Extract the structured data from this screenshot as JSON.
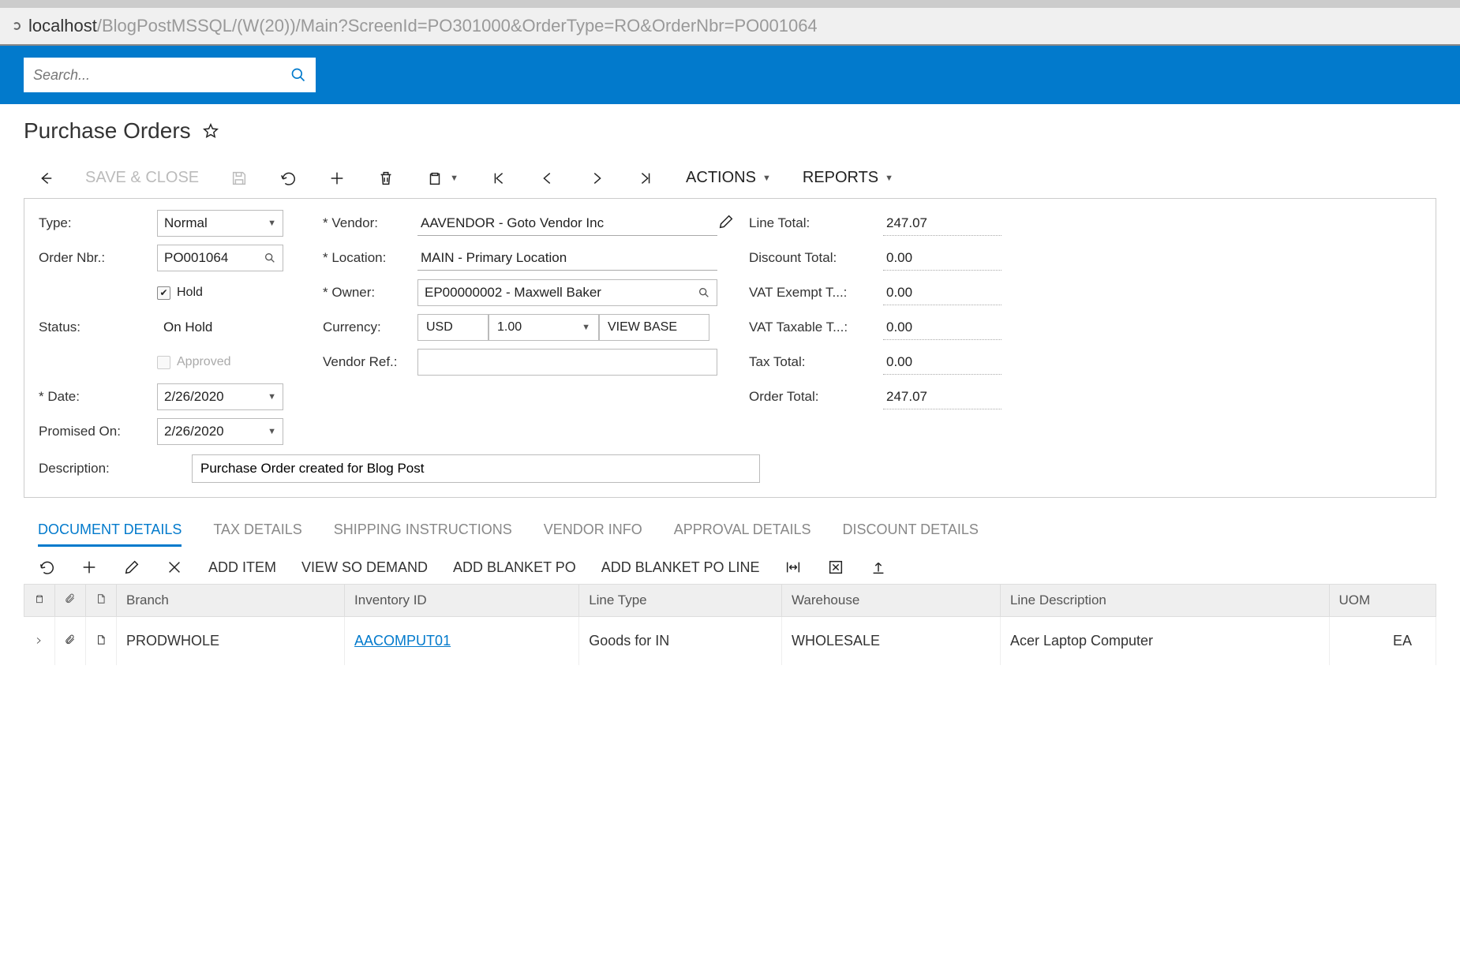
{
  "browser": {
    "url_host": "localhost",
    "url_path": "/BlogPostMSSQL/(W(20))/Main?ScreenId=PO301000&OrderType=RO&OrderNbr=PO001064"
  },
  "search": {
    "placeholder": "Search..."
  },
  "page_title": "Purchase Orders",
  "toolbar": {
    "save_close": "SAVE & CLOSE",
    "actions": "ACTIONS",
    "reports": "REPORTS"
  },
  "form": {
    "type_label": "Type:",
    "type_value": "Normal",
    "order_nbr_label": "Order Nbr.:",
    "order_nbr_value": "PO001064",
    "hold_label": "Hold",
    "status_label": "Status:",
    "status_value": "On Hold",
    "approved_label": "Approved",
    "date_label": "Date:",
    "date_value": "2/26/2020",
    "promised_label": "Promised On:",
    "promised_value": "2/26/2020",
    "description_label": "Description:",
    "description_value": "Purchase Order created for Blog Post",
    "vendor_label": "Vendor:",
    "vendor_value": "AAVENDOR - Goto Vendor Inc",
    "location_label": "Location:",
    "location_value": "MAIN - Primary Location",
    "owner_label": "Owner:",
    "owner_value": "EP00000002 - Maxwell Baker",
    "currency_label": "Currency:",
    "currency_code": "USD",
    "currency_rate": "1.00",
    "view_base": "VIEW BASE",
    "vendor_ref_label": "Vendor Ref.:"
  },
  "totals": {
    "line_total_label": "Line Total:",
    "line_total_value": "247.07",
    "discount_label": "Discount Total:",
    "discount_value": "0.00",
    "vat_exempt_label": "VAT Exempt T...:",
    "vat_exempt_value": "0.00",
    "vat_taxable_label": "VAT Taxable T...:",
    "vat_taxable_value": "0.00",
    "tax_total_label": "Tax Total:",
    "tax_total_value": "0.00",
    "order_total_label": "Order Total:",
    "order_total_value": "247.07"
  },
  "tabs": [
    "DOCUMENT DETAILS",
    "TAX DETAILS",
    "SHIPPING INSTRUCTIONS",
    "VENDOR INFO",
    "APPROVAL DETAILS",
    "DISCOUNT DETAILS"
  ],
  "grid_toolbar": {
    "add_item": "ADD ITEM",
    "view_so": "VIEW SO DEMAND",
    "add_blanket": "ADD BLANKET PO",
    "add_blanket_line": "ADD BLANKET PO LINE"
  },
  "grid": {
    "headers": {
      "branch": "Branch",
      "inventory_id": "Inventory ID",
      "line_type": "Line Type",
      "warehouse": "Warehouse",
      "line_description": "Line Description",
      "uom": "UOM"
    },
    "row": {
      "branch": "PRODWHOLE",
      "inventory_id": "AACOMPUT01",
      "line_type": "Goods for IN",
      "warehouse": "WHOLESALE",
      "line_description": "Acer Laptop Computer",
      "uom": "EA"
    }
  }
}
